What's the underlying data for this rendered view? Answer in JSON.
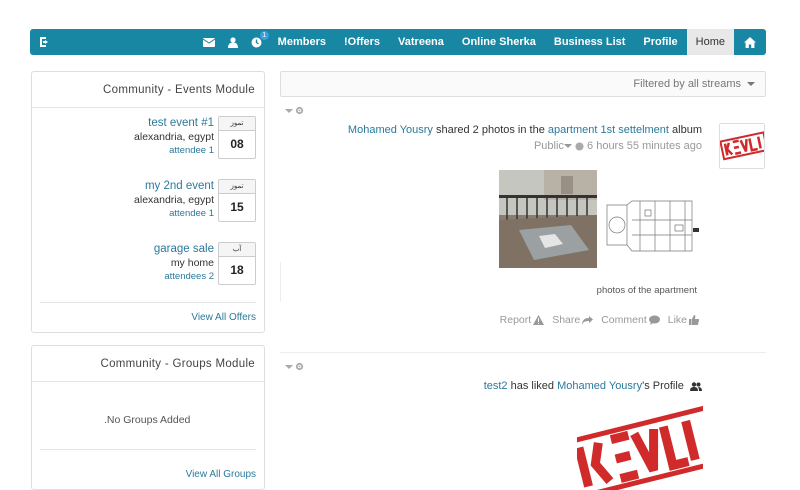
{
  "nav": {
    "notification_count": "1",
    "items": [
      "Members",
      "!Offers",
      "Vatreena",
      "Online Sherka",
      "Business List",
      "Profile"
    ],
    "active_item": "Home"
  },
  "events_module": {
    "title": "Community - Events Module",
    "events": [
      {
        "name": "test event #1",
        "location": "alexandria, egypt",
        "attendees": "attendee 1",
        "month": "تموز",
        "day": "08"
      },
      {
        "name": "my 2nd event",
        "location": "alexandria, egypt",
        "attendees": "attendee 1",
        "month": "تموز",
        "day": "15"
      },
      {
        "name": "garage sale",
        "location": "my home",
        "attendees": "attendees 2",
        "month": "آب",
        "day": "18"
      }
    ],
    "footer_link": "View All Offers"
  },
  "groups_module": {
    "title": "Community - Groups Module",
    "empty_text": ".No Groups Added",
    "footer_link": "View All Groups"
  },
  "feed": {
    "filter_label": "Filtered by all streams",
    "posts": [
      {
        "actor": "Mohamed Yousry",
        "action_text": "shared 2 photos in the",
        "target": "apartment 1st settelment",
        "suffix": "album",
        "privacy": "Public",
        "time": "6 hours 55 minutes ago",
        "caption": "photos of the apartment",
        "actions": {
          "report": "Report",
          "share": "Share",
          "comment": "Comment",
          "like": "Like"
        }
      },
      {
        "actor": "test2",
        "action_text": "has liked",
        "target": "Mohamed Yousry",
        "suffix": "'s Profile"
      }
    ]
  },
  "colors": {
    "navbar": "#1787a3",
    "link": "#2b7a9b",
    "active_nav_bg": "#e8e8e8"
  }
}
